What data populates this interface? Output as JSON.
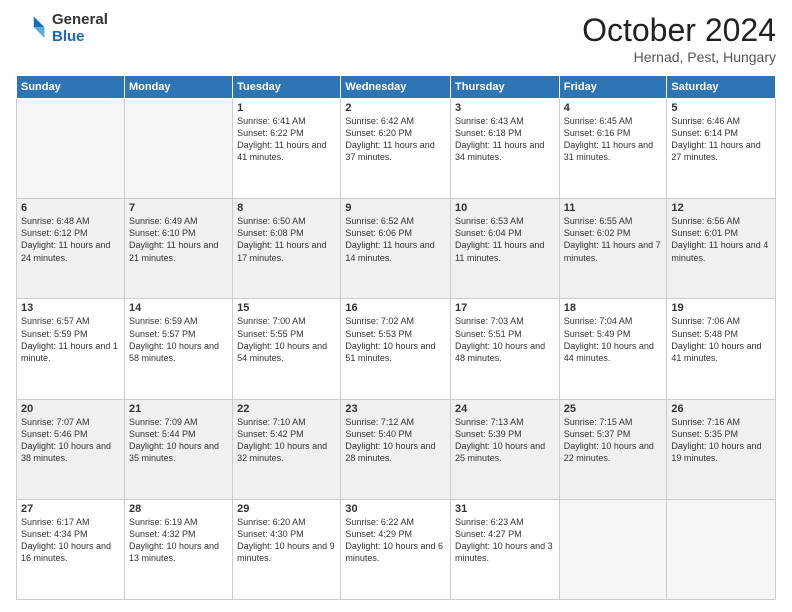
{
  "logo": {
    "general": "General",
    "blue": "Blue"
  },
  "title": {
    "month_year": "October 2024",
    "location": "Hernad, Pest, Hungary"
  },
  "headers": [
    "Sunday",
    "Monday",
    "Tuesday",
    "Wednesday",
    "Thursday",
    "Friday",
    "Saturday"
  ],
  "weeks": [
    [
      {
        "day": "",
        "info": ""
      },
      {
        "day": "",
        "info": ""
      },
      {
        "day": "1",
        "info": "Sunrise: 6:41 AM\nSunset: 6:22 PM\nDaylight: 11 hours and 41 minutes."
      },
      {
        "day": "2",
        "info": "Sunrise: 6:42 AM\nSunset: 6:20 PM\nDaylight: 11 hours and 37 minutes."
      },
      {
        "day": "3",
        "info": "Sunrise: 6:43 AM\nSunset: 6:18 PM\nDaylight: 11 hours and 34 minutes."
      },
      {
        "day": "4",
        "info": "Sunrise: 6:45 AM\nSunset: 6:16 PM\nDaylight: 11 hours and 31 minutes."
      },
      {
        "day": "5",
        "info": "Sunrise: 6:46 AM\nSunset: 6:14 PM\nDaylight: 11 hours and 27 minutes."
      }
    ],
    [
      {
        "day": "6",
        "info": "Sunrise: 6:48 AM\nSunset: 6:12 PM\nDaylight: 11 hours and 24 minutes."
      },
      {
        "day": "7",
        "info": "Sunrise: 6:49 AM\nSunset: 6:10 PM\nDaylight: 11 hours and 21 minutes."
      },
      {
        "day": "8",
        "info": "Sunrise: 6:50 AM\nSunset: 6:08 PM\nDaylight: 11 hours and 17 minutes."
      },
      {
        "day": "9",
        "info": "Sunrise: 6:52 AM\nSunset: 6:06 PM\nDaylight: 11 hours and 14 minutes."
      },
      {
        "day": "10",
        "info": "Sunrise: 6:53 AM\nSunset: 6:04 PM\nDaylight: 11 hours and 11 minutes."
      },
      {
        "day": "11",
        "info": "Sunrise: 6:55 AM\nSunset: 6:02 PM\nDaylight: 11 hours and 7 minutes."
      },
      {
        "day": "12",
        "info": "Sunrise: 6:56 AM\nSunset: 6:01 PM\nDaylight: 11 hours and 4 minutes."
      }
    ],
    [
      {
        "day": "13",
        "info": "Sunrise: 6:57 AM\nSunset: 5:59 PM\nDaylight: 11 hours and 1 minute."
      },
      {
        "day": "14",
        "info": "Sunrise: 6:59 AM\nSunset: 5:57 PM\nDaylight: 10 hours and 58 minutes."
      },
      {
        "day": "15",
        "info": "Sunrise: 7:00 AM\nSunset: 5:55 PM\nDaylight: 10 hours and 54 minutes."
      },
      {
        "day": "16",
        "info": "Sunrise: 7:02 AM\nSunset: 5:53 PM\nDaylight: 10 hours and 51 minutes."
      },
      {
        "day": "17",
        "info": "Sunrise: 7:03 AM\nSunset: 5:51 PM\nDaylight: 10 hours and 48 minutes."
      },
      {
        "day": "18",
        "info": "Sunrise: 7:04 AM\nSunset: 5:49 PM\nDaylight: 10 hours and 44 minutes."
      },
      {
        "day": "19",
        "info": "Sunrise: 7:06 AM\nSunset: 5:48 PM\nDaylight: 10 hours and 41 minutes."
      }
    ],
    [
      {
        "day": "20",
        "info": "Sunrise: 7:07 AM\nSunset: 5:46 PM\nDaylight: 10 hours and 38 minutes."
      },
      {
        "day": "21",
        "info": "Sunrise: 7:09 AM\nSunset: 5:44 PM\nDaylight: 10 hours and 35 minutes."
      },
      {
        "day": "22",
        "info": "Sunrise: 7:10 AM\nSunset: 5:42 PM\nDaylight: 10 hours and 32 minutes."
      },
      {
        "day": "23",
        "info": "Sunrise: 7:12 AM\nSunset: 5:40 PM\nDaylight: 10 hours and 28 minutes."
      },
      {
        "day": "24",
        "info": "Sunrise: 7:13 AM\nSunset: 5:39 PM\nDaylight: 10 hours and 25 minutes."
      },
      {
        "day": "25",
        "info": "Sunrise: 7:15 AM\nSunset: 5:37 PM\nDaylight: 10 hours and 22 minutes."
      },
      {
        "day": "26",
        "info": "Sunrise: 7:16 AM\nSunset: 5:35 PM\nDaylight: 10 hours and 19 minutes."
      }
    ],
    [
      {
        "day": "27",
        "info": "Sunrise: 6:17 AM\nSunset: 4:34 PM\nDaylight: 10 hours and 16 minutes."
      },
      {
        "day": "28",
        "info": "Sunrise: 6:19 AM\nSunset: 4:32 PM\nDaylight: 10 hours and 13 minutes."
      },
      {
        "day": "29",
        "info": "Sunrise: 6:20 AM\nSunset: 4:30 PM\nDaylight: 10 hours and 9 minutes."
      },
      {
        "day": "30",
        "info": "Sunrise: 6:22 AM\nSunset: 4:29 PM\nDaylight: 10 hours and 6 minutes."
      },
      {
        "day": "31",
        "info": "Sunrise: 6:23 AM\nSunset: 4:27 PM\nDaylight: 10 hours and 3 minutes."
      },
      {
        "day": "",
        "info": ""
      },
      {
        "day": "",
        "info": ""
      }
    ]
  ]
}
